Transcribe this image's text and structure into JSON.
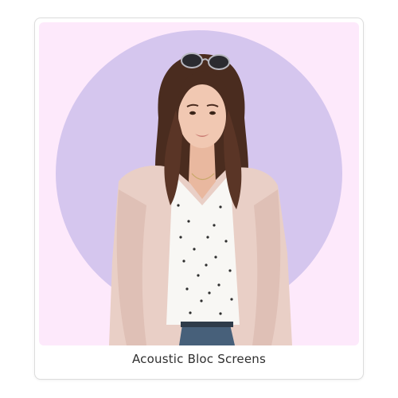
{
  "card": {
    "caption": "Acoustic Bloc Screens",
    "image": {
      "subject": "woman with sunglasses on head, polka-dot blouse and pink cardigan",
      "colors": {
        "background": "#fde9fb",
        "circle": "#d5c6ee",
        "cardigan": "#e9cfc6",
        "hair": "#4a2c1f",
        "skin": "#f1c8b2",
        "blouse": "#f8f7f4",
        "jeans": "#47607a"
      }
    }
  }
}
